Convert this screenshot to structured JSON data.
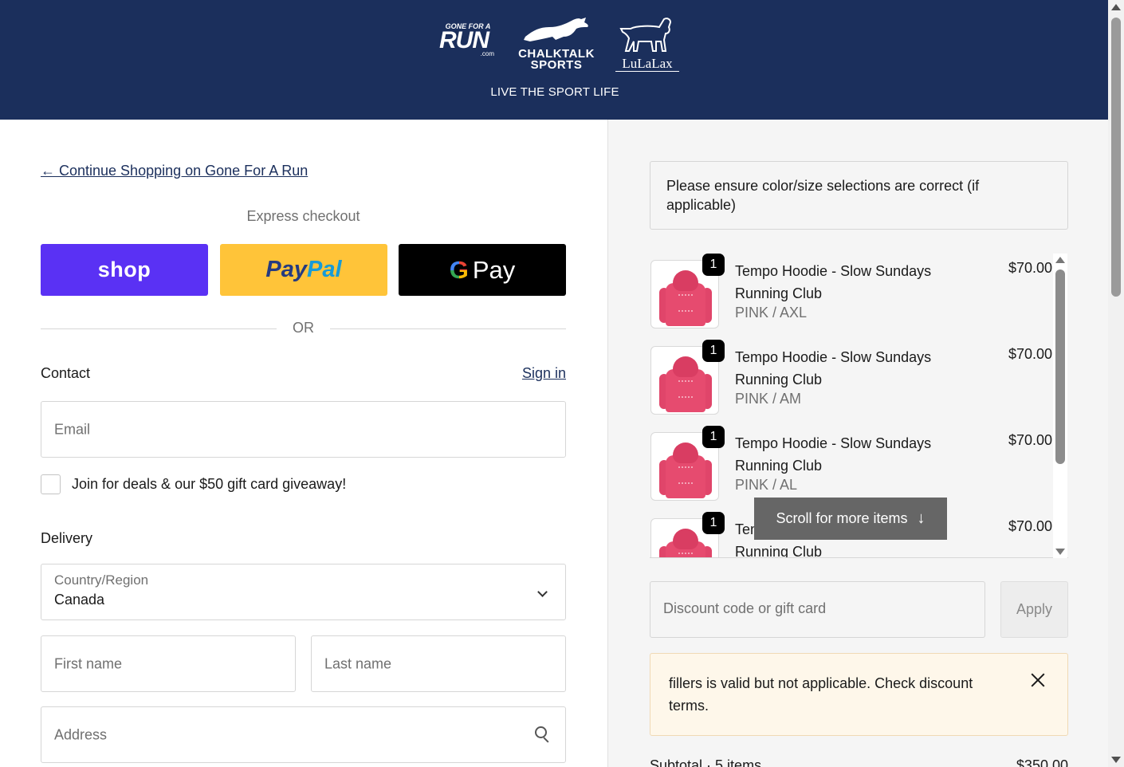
{
  "header": {
    "logos": {
      "gfar_top": "GONE FOR A",
      "gfar_main": "RUN",
      "gfar_com": ".com",
      "chalktalk_line1": "CHALKTALK",
      "chalktalk_line2": "SPORTS",
      "lulalax": "LuLaLax"
    },
    "tagline": "LIVE THE SPORT LIFE",
    "background_color": "#1b2f5c"
  },
  "checkout": {
    "continue_link": "← Continue Shopping on Gone For A Run",
    "express_title": "Express checkout",
    "express_buttons": {
      "shop": "shop",
      "paypal_pay": "Pay",
      "paypal_pal": "Pal",
      "gpay_g": "G",
      "gpay_pay": "Pay"
    },
    "or_label": "OR",
    "contact": {
      "title": "Contact",
      "signin": "Sign in",
      "email_placeholder": "Email",
      "newsletter_label": "Join for deals & our $50 gift card giveaway!",
      "newsletter_checked": false
    },
    "delivery": {
      "title": "Delivery",
      "country_label": "Country/Region",
      "country_value": "Canada",
      "first_name_placeholder": "First name",
      "last_name_placeholder": "Last name",
      "address_placeholder": "Address"
    }
  },
  "summary": {
    "notice": "Please ensure color/size selections are correct (if applicable)",
    "items": [
      {
        "qty": "1",
        "name": "Tempo Hoodie - Slow Sundays Running Club",
        "variant": "PINK / AXL",
        "price": "$70.00"
      },
      {
        "qty": "1",
        "name": "Tempo Hoodie - Slow Sundays Running Club",
        "variant": "PINK / AM",
        "price": "$70.00"
      },
      {
        "qty": "1",
        "name": "Tempo Hoodie - Slow Sundays Running Club",
        "variant": "PINK / AL",
        "price": "$70.00"
      },
      {
        "qty": "1",
        "name": "Tempo Hoodie - Slow Sundays Running Club",
        "variant": "",
        "price": "$70.00"
      }
    ],
    "scroll_more": "Scroll for more items",
    "discount_placeholder": "Discount code or gift card",
    "apply_label": "Apply",
    "alert_message": "fillers is valid but not applicable. Check discount terms.",
    "subtotal_label": "Subtotal · 5 items",
    "subtotal_amount": "$350.00"
  },
  "colors": {
    "shop_pay": "#5a31f4",
    "paypal": "#ffc439",
    "gpay": "#000000",
    "alert_bg": "#fef7ea"
  }
}
